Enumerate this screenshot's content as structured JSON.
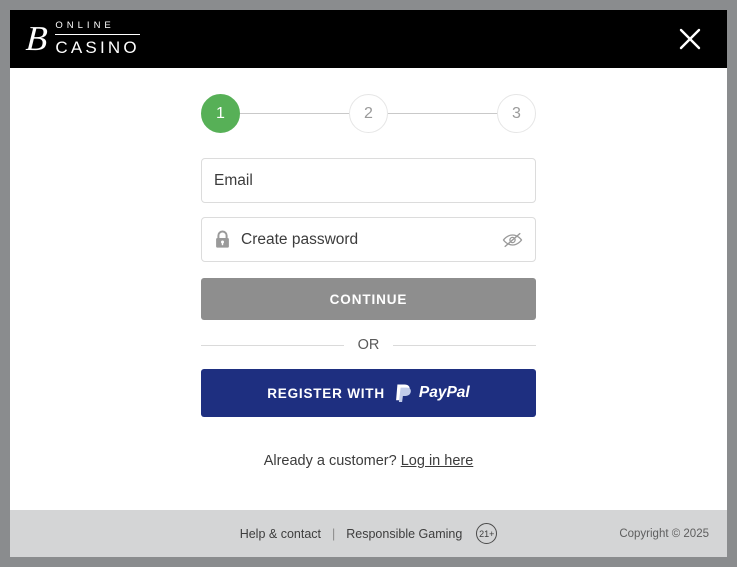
{
  "header": {
    "logo": {
      "monogram": "B",
      "line1": "ONLINE",
      "line2": "CASINO"
    },
    "close_icon": "close-icon"
  },
  "stepper": {
    "steps": [
      {
        "number": "1",
        "state": "active"
      },
      {
        "number": "2",
        "state": "idle"
      },
      {
        "number": "3",
        "state": "idle"
      }
    ]
  },
  "form": {
    "email": {
      "value": "Email",
      "placeholder": "Email"
    },
    "password": {
      "value": "Create password",
      "placeholder": "Create password",
      "lock_icon": "lock-icon",
      "visibility_icon": "eye-off-icon"
    },
    "continue_label": "CONTINUE",
    "divider_label": "OR",
    "paypal": {
      "label": "REGISTER WITH",
      "brand": "PayPal"
    },
    "login_prompt": "Already a customer?",
    "login_link": "Log in here"
  },
  "footer": {
    "help_label": "Help & contact",
    "separator": "|",
    "responsible_label": "Responsible Gaming",
    "age_badge": "21+",
    "copyright": "Copyright © 2025"
  },
  "colors": {
    "accent_green": "#57b057",
    "paypal_blue": "#1e2f80",
    "disabled_gray": "#8e8e8e",
    "header_black": "#000000",
    "footer_gray": "#d4d5d6",
    "backdrop_gray": "#8a8c8e"
  }
}
